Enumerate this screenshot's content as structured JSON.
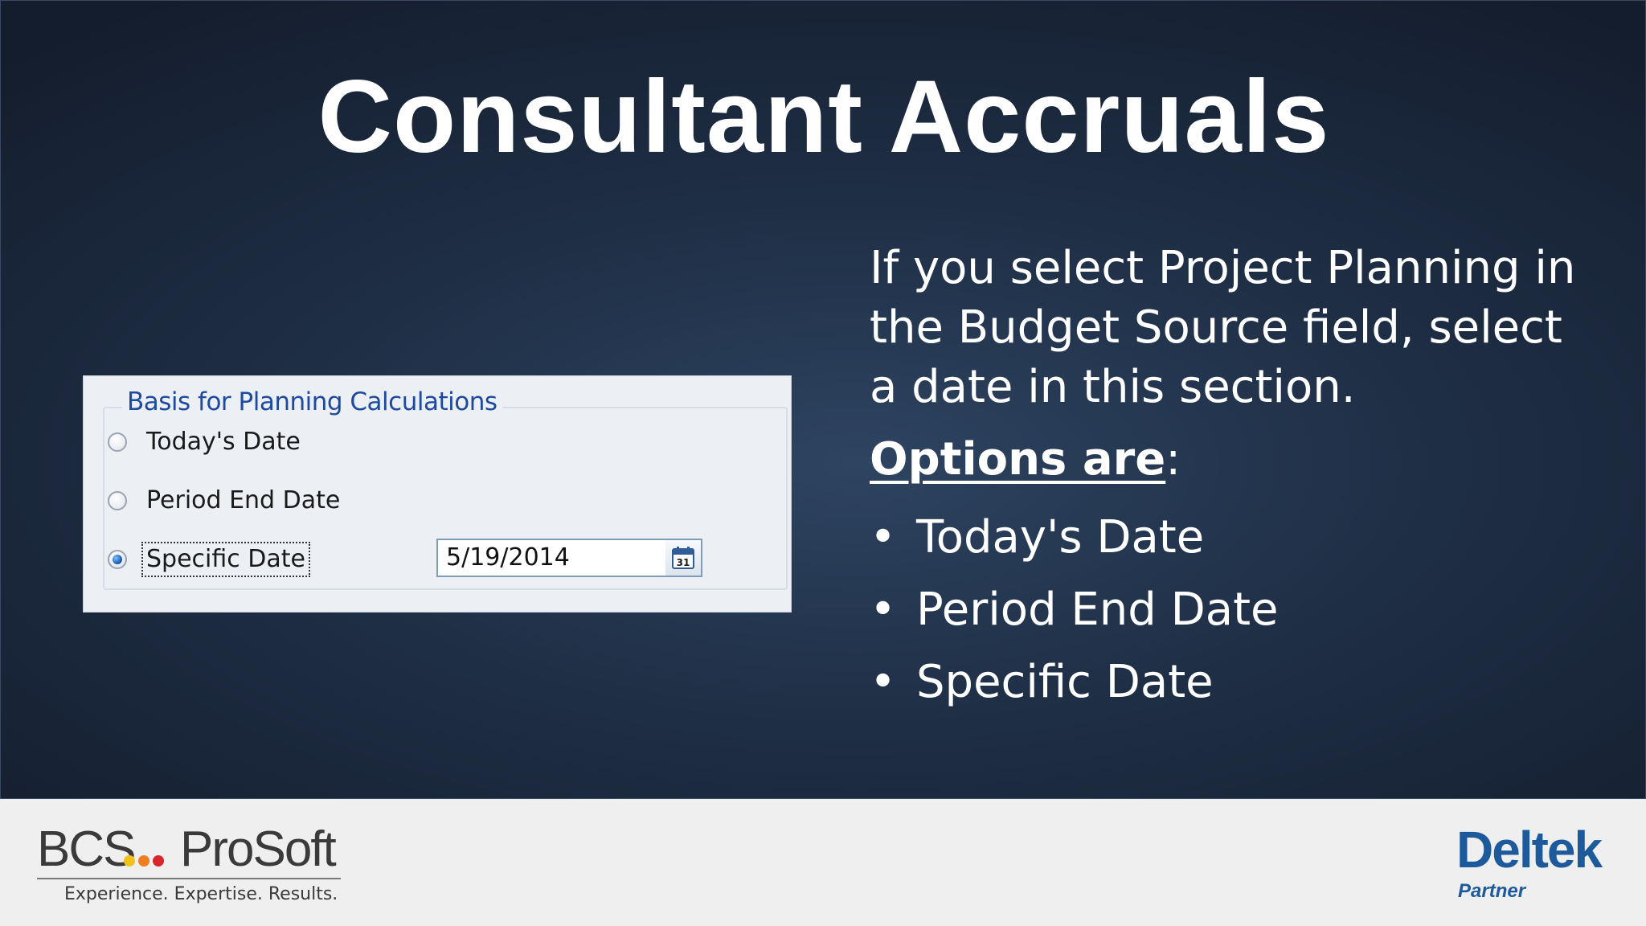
{
  "slide": {
    "title": "Consultant Accruals",
    "body": "If you select Project Planning in the Budget Source field, select a date in this section.",
    "options_heading": "Options are",
    "options_suffix": ":",
    "options": [
      "Today's Date",
      "Period End Date",
      "Specific Date"
    ],
    "bullet_glyph": "•"
  },
  "dialog": {
    "group_title": "Basis for Planning Calculations",
    "radios": [
      {
        "label": "Today's Date",
        "checked": false
      },
      {
        "label": "Period End Date",
        "checked": false
      },
      {
        "label": "Specific Date",
        "checked": true
      }
    ],
    "date_value": "5/19/2014",
    "calendar_icon": "calendar-icon",
    "calendar_day": "31"
  },
  "footer": {
    "bcs_logo": {
      "left": "BCS",
      "right": "ProSoft",
      "tagline": "Experience. Expertise. Results.",
      "dot_colors": [
        "#f2c21b",
        "#ef7d22",
        "#d8262c"
      ]
    },
    "deltek_logo": {
      "name": "Deltek",
      "sub": "Partner",
      "color": "#1d5a9c"
    }
  },
  "colors": {
    "slide_bg": "#1f2f46",
    "footer_bg": "#efefef",
    "dialog_bg": "#ecf0f4",
    "group_title": "#1d4aa0"
  }
}
